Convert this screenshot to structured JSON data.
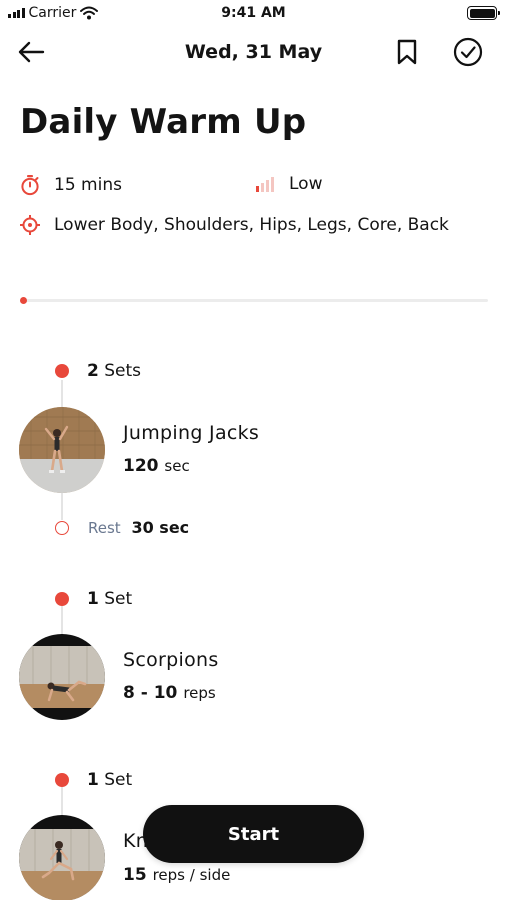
{
  "status_bar": {
    "carrier": "Carrier",
    "time": "9:41 AM",
    "icons": [
      "signal-icon",
      "wifi-icon",
      "battery-icon"
    ]
  },
  "nav": {
    "title": "Wed, 31 May",
    "icons": [
      "back-arrow-icon",
      "bookmark-icon",
      "check-circle-icon"
    ]
  },
  "workout": {
    "title": "Daily Warm Up",
    "duration": "15 mins",
    "intensity": "Low",
    "focus_areas": "Lower Body, Shoulders, Hips, Legs, Core, Back",
    "progress": 0
  },
  "blocks": [
    {
      "sets": "2",
      "sets_unit": "Sets",
      "exercise": "Jumping Jacks",
      "amount": "120",
      "unit": "sec",
      "rest_label": "Rest",
      "rest_value": "30 sec"
    },
    {
      "sets": "1",
      "sets_unit": "Set",
      "exercise": "Scorpions",
      "amount": "8 - 10",
      "unit": "reps"
    },
    {
      "sets": "1",
      "sets_unit": "Set",
      "exercise": "Kn",
      "amount": "15",
      "unit": "reps / side"
    }
  ],
  "start_button": {
    "label": "Start"
  },
  "colors": {
    "accent": "#e8483b",
    "button": "#111111",
    "rest_label": "#6a7890"
  }
}
